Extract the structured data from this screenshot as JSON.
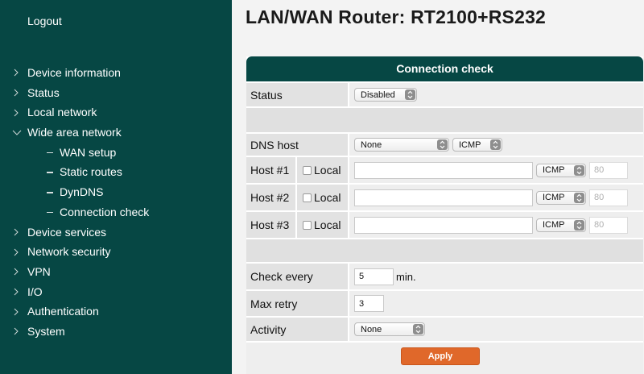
{
  "sidebar": {
    "logout": "Logout",
    "items": [
      {
        "label": "Device information",
        "expanded": false
      },
      {
        "label": "Status",
        "expanded": false
      },
      {
        "label": "Local network",
        "expanded": false
      },
      {
        "label": "Wide area network",
        "expanded": true
      },
      {
        "label": "WAN setup"
      },
      {
        "label": "Static routes"
      },
      {
        "label": "DynDNS"
      },
      {
        "label": "Connection check"
      },
      {
        "label": "Device services",
        "expanded": false
      },
      {
        "label": "Network security",
        "expanded": false
      },
      {
        "label": "VPN",
        "expanded": false
      },
      {
        "label": "I/O",
        "expanded": false
      },
      {
        "label": "Authentication",
        "expanded": false
      },
      {
        "label": "System",
        "expanded": false
      }
    ]
  },
  "header": {
    "title": "LAN/WAN Router: RT2100+RS232"
  },
  "panel": {
    "title": "Connection check",
    "status": {
      "label": "Status",
      "value": "Disabled"
    },
    "dns_host": {
      "label": "DNS host",
      "value": "None",
      "protocol": "ICMP"
    },
    "hosts": [
      {
        "label": "Host #1",
        "local_label": "Local",
        "address": "",
        "protocol": "ICMP",
        "port_placeholder": "80"
      },
      {
        "label": "Host #2",
        "local_label": "Local",
        "address": "",
        "protocol": "ICMP",
        "port_placeholder": "80"
      },
      {
        "label": "Host #3",
        "local_label": "Local",
        "address": "",
        "protocol": "ICMP",
        "port_placeholder": "80"
      }
    ],
    "check_every": {
      "label": "Check every",
      "value": "5",
      "unit": "min."
    },
    "max_retry": {
      "label": "Max retry",
      "value": "3"
    },
    "activity": {
      "label": "Activity",
      "value": "None"
    },
    "apply_label": "Apply"
  },
  "colors": {
    "sidebar_bg": "#064744",
    "panel_header_bg": "#064744",
    "apply_bg": "#e0682a"
  }
}
